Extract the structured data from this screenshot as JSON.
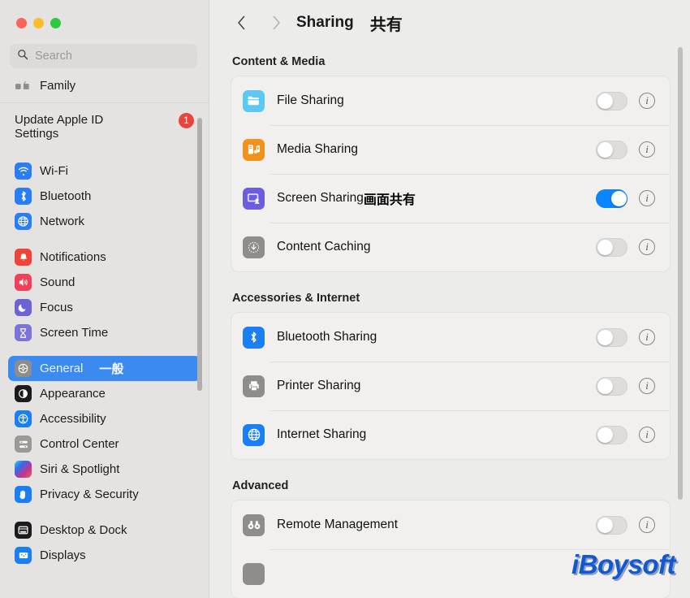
{
  "window": {
    "traffic_lights": [
      "close",
      "minimize",
      "zoom"
    ],
    "colors": {
      "accent_blue": "#0a84ff",
      "selected_row": "#3b8aef",
      "badge_red": "#e8453c",
      "sidebar_bg": "#e4e3e1",
      "content_bg": "#ececea",
      "card_bg": "#f1f0ee"
    }
  },
  "search": {
    "placeholder": "Search",
    "value": "",
    "icon": "search-icon"
  },
  "sidebar": {
    "account_items": [
      {
        "label": "Family",
        "icon": "family-icon",
        "icon_color": "#8e8d8b",
        "partial": true
      }
    ],
    "update_item": {
      "label": "Update Apple ID Settings",
      "badge": "1"
    },
    "groups": [
      {
        "items": [
          {
            "label": "Wi-Fi",
            "icon": "wifi-icon",
            "icon_color": "#2a7df4"
          },
          {
            "label": "Bluetooth",
            "icon": "bluetooth-icon",
            "icon_color": "#2a7df4"
          },
          {
            "label": "Network",
            "icon": "network-globe-icon",
            "icon_color": "#2a7df4"
          }
        ]
      },
      {
        "items": [
          {
            "label": "Notifications",
            "icon": "notifications-bell-icon",
            "icon_color": "#f04438"
          },
          {
            "label": "Sound",
            "icon": "sound-speaker-icon",
            "icon_color": "#f2405a"
          },
          {
            "label": "Focus",
            "icon": "focus-moon-icon",
            "icon_color": "#6b63d6"
          },
          {
            "label": "Screen Time",
            "icon": "screen-time-hourglass-icon",
            "icon_color": "#7b74db"
          }
        ]
      },
      {
        "items": [
          {
            "label": "General",
            "label_cjk": "一般",
            "icon": "general-gear-icon",
            "icon_color": "#8e8d8b",
            "selected": true
          },
          {
            "label": "Appearance",
            "icon": "appearance-contrast-icon",
            "icon_color": "#1b1b1b"
          },
          {
            "label": "Accessibility",
            "icon": "accessibility-icon",
            "icon_color": "#1a7ef5"
          },
          {
            "label": "Control Center",
            "icon": "control-center-icon",
            "icon_color": "#9a9997"
          },
          {
            "label": "Siri & Spotlight",
            "icon": "siri-icon",
            "icon_color": "#c2448e"
          },
          {
            "label": "Privacy & Security",
            "icon": "privacy-hand-icon",
            "icon_color": "#1a7ef5"
          }
        ]
      },
      {
        "items": [
          {
            "label": "Desktop & Dock",
            "icon": "desktop-dock-icon",
            "icon_color": "#1b1b1b"
          },
          {
            "label": "Displays",
            "icon": "displays-icon",
            "icon_color": "#1a7ef5",
            "partial": true
          }
        ]
      }
    ]
  },
  "toolbar": {
    "back_icon": "chevron-left-icon",
    "forward_icon": "chevron-right-icon",
    "title": "Sharing",
    "title_cjk": "共有"
  },
  "main": {
    "sections": [
      {
        "title": "Content & Media",
        "rows": [
          {
            "label": "File Sharing",
            "icon": "file-sharing-folder-icon",
            "icon_color": "#5bc8f5",
            "toggle": "off",
            "info": "i"
          },
          {
            "label": "Media Sharing",
            "icon": "media-sharing-music-icon",
            "icon_color": "#f2921d",
            "toggle": "off",
            "info": "i"
          },
          {
            "label": "Screen Sharing",
            "label_cjk": "画面共有",
            "icon": "screen-sharing-icon",
            "icon_color": "#6c5ce0",
            "toggle": "on",
            "info": "i"
          },
          {
            "label": "Content Caching",
            "icon": "content-caching-download-icon",
            "icon_color": "#8e8d8b",
            "toggle": "off",
            "info": "i"
          }
        ]
      },
      {
        "title": "Accessories & Internet",
        "rows": [
          {
            "label": "Bluetooth Sharing",
            "icon": "bluetooth-sharing-icon",
            "icon_color": "#1a7ef5",
            "toggle": "off",
            "info": "i"
          },
          {
            "label": "Printer Sharing",
            "icon": "printer-sharing-icon",
            "icon_color": "#8e8d8b",
            "toggle": "off",
            "info": "i"
          },
          {
            "label": "Internet Sharing",
            "icon": "internet-sharing-globe-icon",
            "icon_color": "#1a7ef5",
            "toggle": "off",
            "info": "i"
          }
        ]
      },
      {
        "title": "Advanced",
        "rows": [
          {
            "label": "Remote Management",
            "icon": "remote-management-binoculars-icon",
            "icon_color": "#8e8d8b",
            "toggle": "off",
            "info": "i"
          }
        ]
      }
    ]
  },
  "watermark": {
    "text": "iBoysoft"
  }
}
